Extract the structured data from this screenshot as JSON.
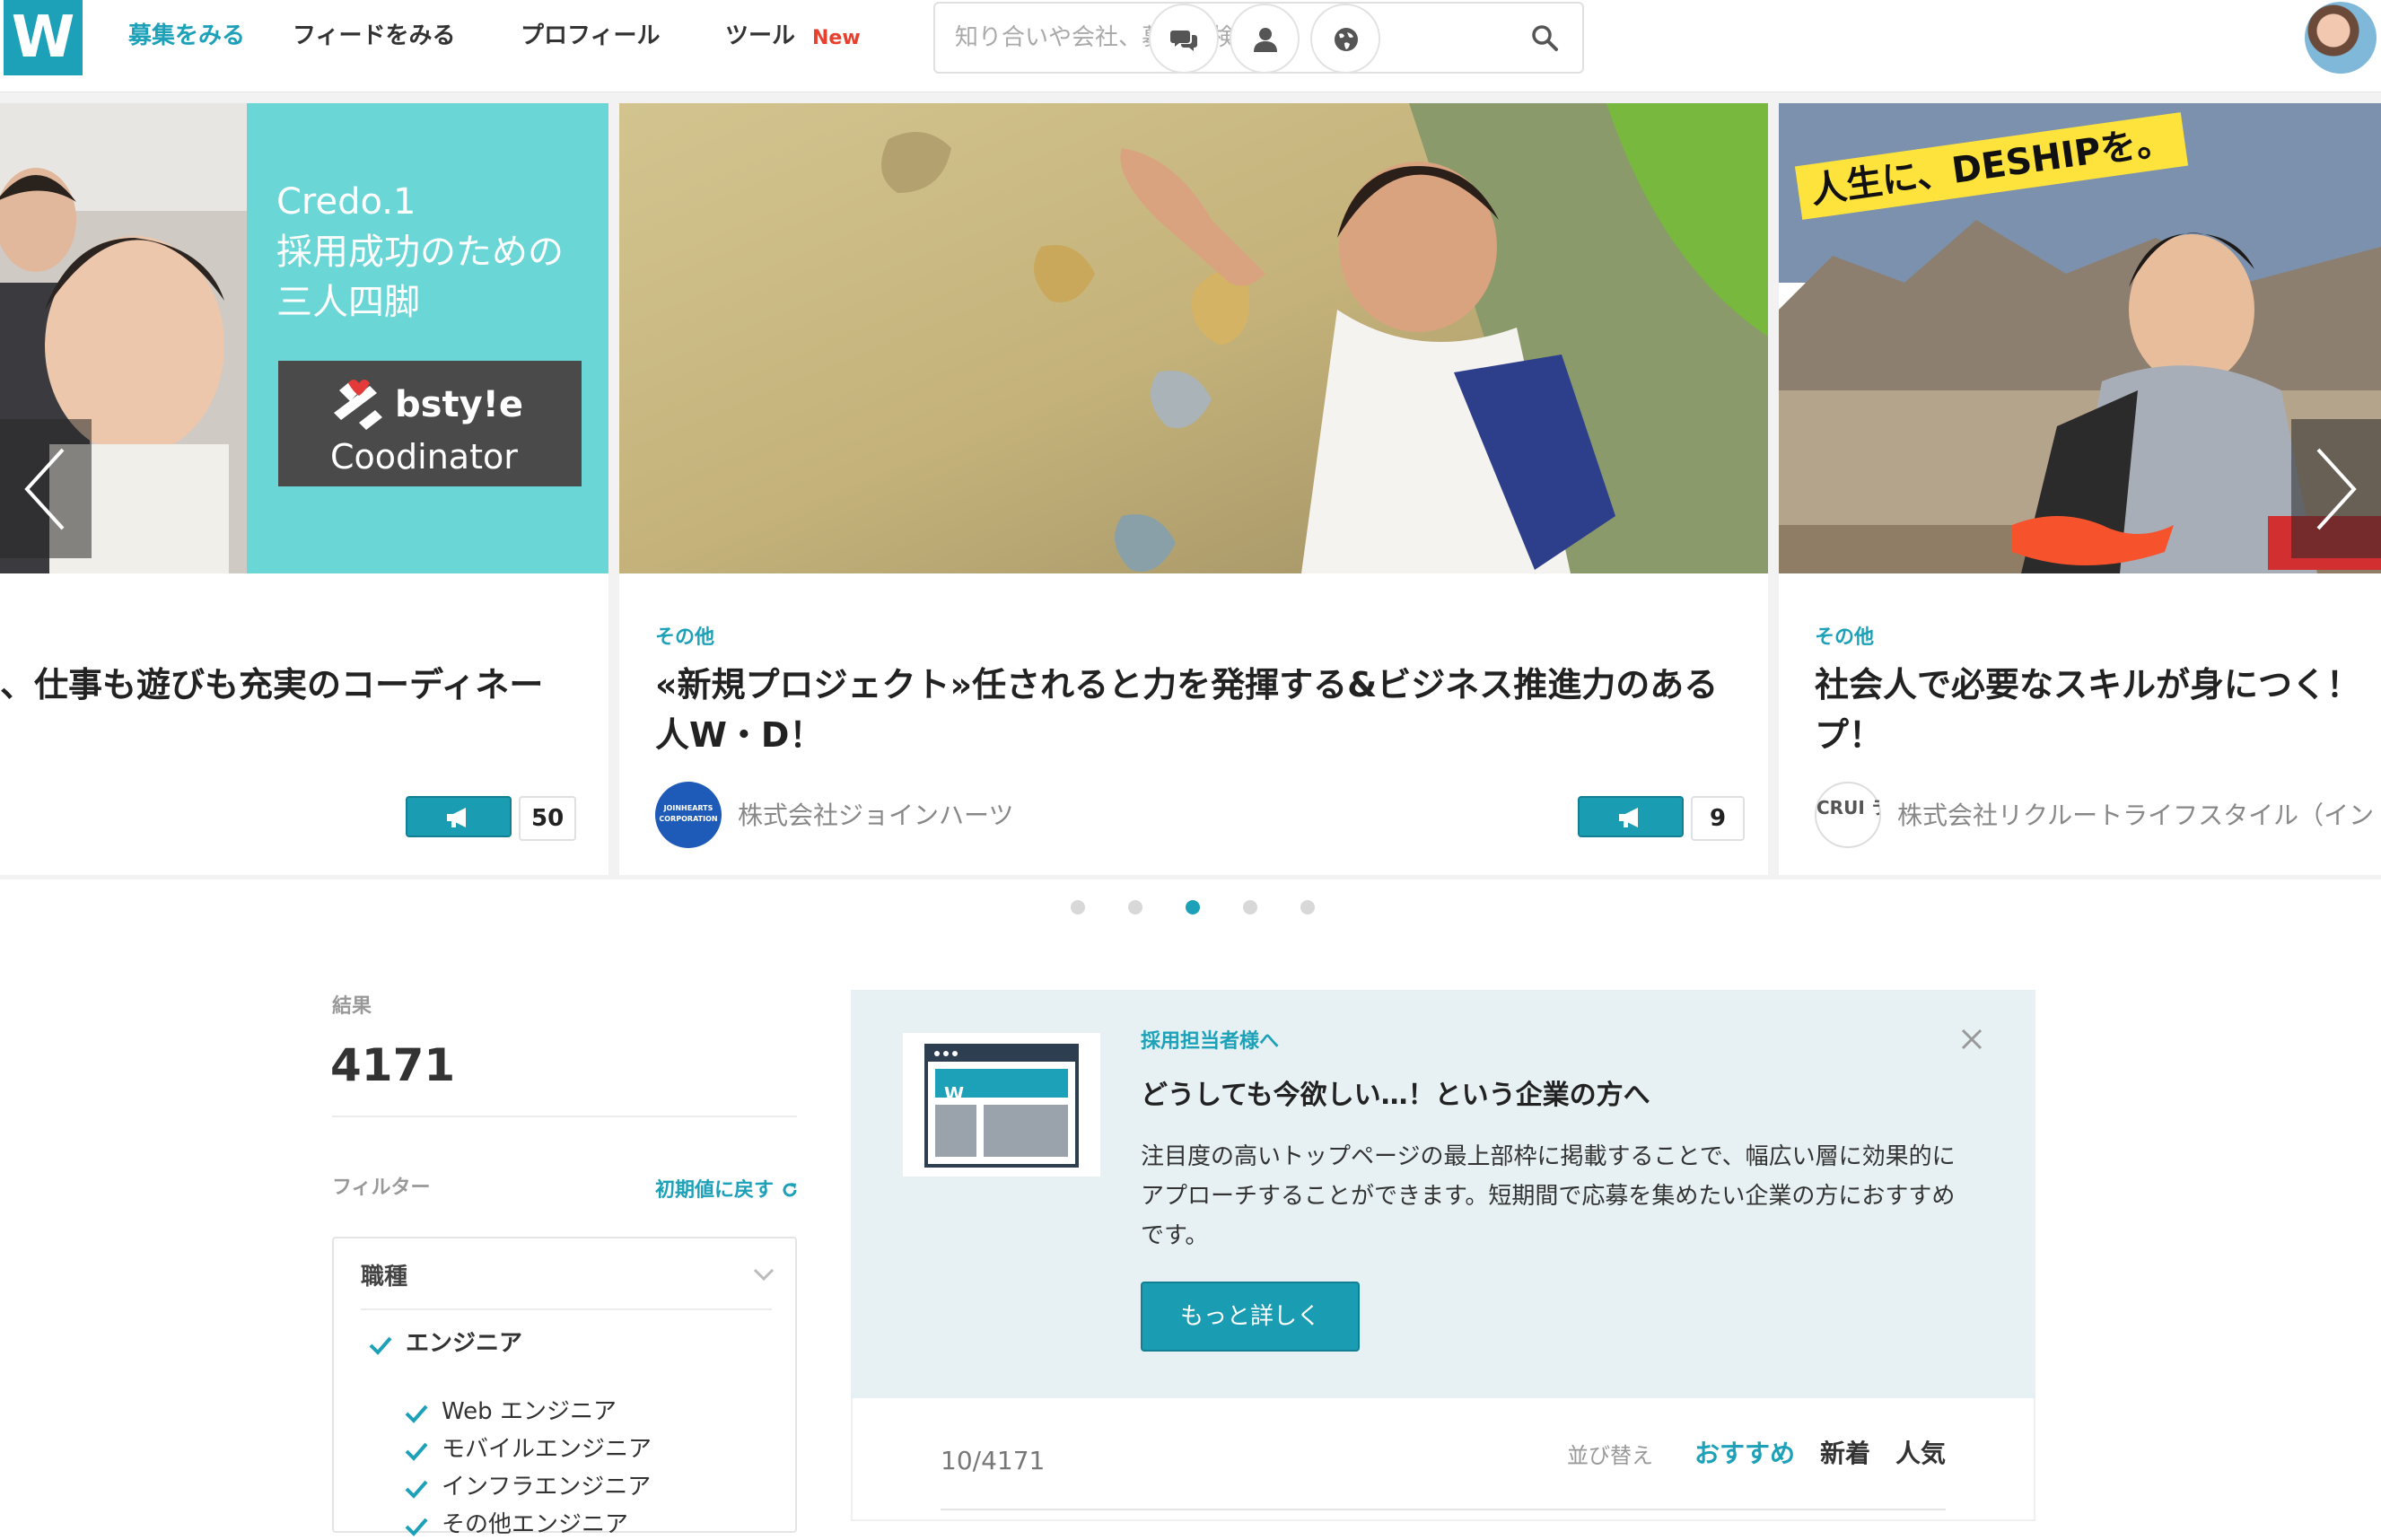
{
  "nav": {
    "logo": "W",
    "links": [
      "募集をみる",
      "フィードをみる",
      "プロフィール",
      "ツール"
    ],
    "new_badge": "New",
    "search_placeholder": "知り合いや会社、募集を検索"
  },
  "carousel": {
    "cards": [
      {
        "banner_lines": [
          "Credo.1",
          "採用成功のための",
          "三人四脚"
        ],
        "banner_brand": "bsty!e",
        "banner_brand_sub": "Coodinator",
        "category": "",
        "title": "、仕事も遊びも充実のコーディネー",
        "company": "",
        "cheers": "50"
      },
      {
        "category": "その他",
        "title": "«新規プロジェクト»任されると力を発揮する&ビジネス推進力のある人W・D！",
        "company": "株式会社ジョインハーツ",
        "company_logo_text": "JOINHEARTS CORPORATION",
        "cheers": "9"
      },
      {
        "banner_text": "人生に、DESHIPを。",
        "category": "その他",
        "title": "社会人で必要なスキルが身につく！プ！",
        "company": "株式会社リクルートライフスタイル（イン",
        "company_logo_text": "CRUI ライ"
      }
    ],
    "dots_total": 5,
    "active_dot": 3
  },
  "sidebar": {
    "results_label": "結果",
    "results_count": "4171",
    "filter_label": "フィルター",
    "reset_label": "初期値に戻す",
    "filter_section": "職種",
    "filter_main": "エンジニア",
    "filter_items": [
      "Web エンジニア",
      "モバイルエンジニア",
      "インフラエンジニア",
      "その他エンジニア"
    ]
  },
  "promo": {
    "kicker": "採用担当者様へ",
    "title": "どうしても今欲しい…！という企業の方へ",
    "body": "注目度の高いトップページの最上部枠に掲載することで、幅広い層に効果的にアプローチすることができます。短期間で応募を集めたい企業の方におすすめです。",
    "button": "もっと詳しく",
    "image_logo": "W"
  },
  "listing": {
    "count": "10/4171",
    "sort_label": "並び替え",
    "sort_options": [
      "おすすめ",
      "新着",
      "人気"
    ]
  },
  "colors": {
    "accent": "#1da1b8",
    "new_badge": "#e8402f",
    "promo_bg": "#e7f1f3"
  }
}
